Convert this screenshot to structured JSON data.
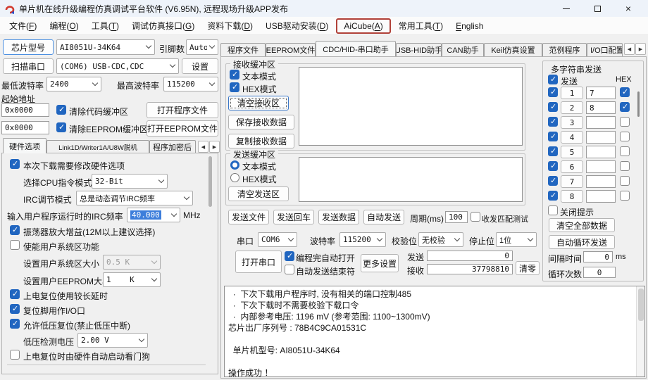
{
  "colors": {
    "accent": "#2166c0",
    "annotation": "#b04038",
    "selection": "#3d7edb"
  },
  "titlebar": {
    "title": "单片机在线升级编程仿真调试平台软件 (V6.95N), 远程现场升级APP发布"
  },
  "menubar": {
    "items": [
      "文件(F)",
      "编程(O)",
      "工具(T)",
      "调试仿真接口(G)",
      "资料下载(D)",
      "USB驱动安装(D)",
      "AiCube(A)",
      "常用工具(T)",
      "English"
    ]
  },
  "chip": {
    "select_button": "芯片型号",
    "model": "AI8051U-34K64",
    "pins_label": "引脚数",
    "pins": "Auto",
    "scan_button": "扫描串口",
    "port": "(COM6) USB-CDC,CDC",
    "settings_button": "设置",
    "min_baud_label": "最低波特率",
    "min_baud": "2400",
    "max_baud_label": "最高波特率",
    "max_baud": "115200"
  },
  "flash": {
    "start_addr_label": "起始地址",
    "code_addr": "0x0000",
    "clear_code_label": "清除代码缓冲区",
    "clear_code_checked": true,
    "open_program_button": "打开程序文件",
    "eeprom_addr": "0x0000",
    "clear_eeprom_label": "清除EEPROM缓冲区",
    "clear_eeprom_checked": true,
    "open_eeprom_button": "打开EEPROM文件"
  },
  "left_tabs": {
    "hw": "硬件选项",
    "offline": "Link1D/Writer1A/U8W脱机",
    "encrypt": "程序加密后"
  },
  "hw": {
    "modify_label": "本次下载需要修改硬件选项",
    "modify_checked": true,
    "cpu_label": "选择CPU指令模式",
    "cpu_mode": "32-Bit",
    "irc_mode_label": "IRC调节模式",
    "irc_mode": "总是动态调节IRC频率",
    "irc_freq_label": "输入用户程序运行时的IRC频率",
    "irc_freq": "40.000",
    "mhz_label": "MHz",
    "osc_gain_label": "振荡器放大增益(12M以上建议选择)",
    "osc_gain_checked": true,
    "user_sys_label": "使能用户系统区功能",
    "user_sys_checked": false,
    "sys_size_label": "设置用户系统区大小",
    "sys_size": "0.5 K",
    "eeprom_size_label": "设置用户EEPROM大小",
    "eeprom_size": "1    K",
    "long_delay_label": "上电复位使用较长延时",
    "long_delay_checked": true,
    "reset_io_label": "复位脚用作I/O口",
    "reset_io_checked": true,
    "lvr_label": "允许低压复位(禁止低压中断)",
    "lvr_checked": true,
    "lvd_label": "低压检测电压",
    "lvd": "2.00 V",
    "watchdog_label": "上电复位时由硬件自动启动看门狗",
    "watchdog_checked": false
  },
  "tabs": {
    "items": [
      "程序文件",
      "EEPROM文件",
      "CDC/HID-串口助手",
      "USB-HID助手",
      "CAN助手",
      "Keil仿真设置",
      "范例程序",
      "I/O口配置"
    ],
    "active": "CDC/HID-串口助手"
  },
  "recv": {
    "legend": "接收缓冲区",
    "text_mode_label": "文本模式",
    "text_mode_checked": true,
    "hex_mode_label": "HEX模式",
    "hex_mode_checked": true,
    "clear_button": "清空接收区",
    "save_button": "保存接收数据",
    "copy_button": "复制接收数据",
    "content": ""
  },
  "send": {
    "legend": "发送缓冲区",
    "text_mode_label": "文本模式",
    "text_mode_selected": true,
    "hex_mode_label": "HEX模式",
    "hex_mode_selected": false,
    "clear_button": "清空发送区",
    "content": "",
    "send_file_button": "发送文件",
    "send_cr_button": "发送回车",
    "send_data_button": "发送数据",
    "auto_send_button": "自动发送",
    "period_label": "周期(ms)",
    "period": "100",
    "match_test_label": "收发匹配测试",
    "match_test_checked": false
  },
  "serial": {
    "port_label": "串口",
    "port": "COM6",
    "baud_label": "波特率",
    "baud": "115200",
    "parity_label": "校验位",
    "parity": "无校验",
    "stop_label": "停止位",
    "stop": "1位",
    "open_button": "打开串口",
    "auto_open_label": "编程完自动打开",
    "auto_open_checked": true,
    "auto_end_label": "自动发送结束符",
    "auto_end_checked": false,
    "more_button": "更多设置",
    "tx_label": "发送",
    "tx_count": "0",
    "rx_label": "接收",
    "rx_count": "37798810",
    "clear_count_button": "清零"
  },
  "multi": {
    "title": "多字符串发送",
    "send_label": "发送",
    "send_all_checked": true,
    "hex_label": "HEX",
    "rows": [
      {
        "index": "1",
        "value": "7",
        "checked": true,
        "hex": true
      },
      {
        "index": "2",
        "value": "8",
        "checked": true,
        "hex": true
      },
      {
        "index": "3",
        "value": "",
        "checked": true,
        "hex": false
      },
      {
        "index": "4",
        "value": "",
        "checked": true,
        "hex": false
      },
      {
        "index": "5",
        "value": "",
        "checked": true,
        "hex": false
      },
      {
        "index": "6",
        "value": "",
        "checked": true,
        "hex": false
      },
      {
        "index": "7",
        "value": "",
        "checked": true,
        "hex": false
      },
      {
        "index": "8",
        "value": "",
        "checked": true,
        "hex": false
      }
    ],
    "close_tip_label": "关闭提示",
    "close_tip_checked": false,
    "clear_all_button": "清空全部数据",
    "auto_loop_button": "自动循环发送",
    "interval_label": "间隔时间",
    "interval": "0",
    "ms_label": "ms",
    "loop_label": "循环次数",
    "loop_count": "0"
  },
  "log": {
    "text": "  ·  下次下载用户程序时, 没有相关的端口控制485\n  ·  下次下载时不需要校验下载口令\n  ·  内部参考电压: 1196 mV (参考范围: 1100~1300mV)\n芯片出厂序列号 : 78B4C9CA01531C\n\n  单片机型号: AI8051U-34K64\n\n操作成功 ！"
  }
}
